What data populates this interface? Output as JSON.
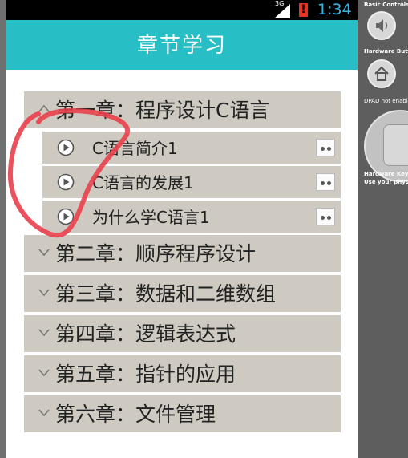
{
  "status_bar": {
    "network": "3G",
    "alert": "!",
    "time": "1:34"
  },
  "titlebar": {
    "title": "章节学习"
  },
  "chapters": [
    {
      "title": "第一章：程序设计C语言",
      "expanded": true,
      "lessons": [
        "C语言简介1",
        "C语言的发展1",
        "为什么学C语言1"
      ]
    },
    {
      "title": "第二章：顺序程序设计",
      "expanded": false
    },
    {
      "title": "第三章：数据和二维数组",
      "expanded": false
    },
    {
      "title": "第四章：逻辑表达式",
      "expanded": false
    },
    {
      "title": "第五章：指针的应用",
      "expanded": false
    },
    {
      "title": "第六章：文件管理",
      "expanded": false
    }
  ],
  "emulator_panel": {
    "basic_controls": "Basic Controls",
    "hardware_buttons": "Hardware Buttons",
    "dpad": "DPAD not enabled",
    "hardware_keyboard": "Hardware Keyboard",
    "keyboard_hint": "Use your physical keyboard"
  },
  "icons": {
    "chevron": "chevron-down-icon",
    "play": "play-circle-icon",
    "more": "more-dots-icon",
    "volume": "volume-icon",
    "home": "home-icon"
  },
  "colors": {
    "titlebar": "#27bec6",
    "row_background": "#cfcac1",
    "clock": "#33b5e5",
    "annotation": "#e8404d"
  }
}
